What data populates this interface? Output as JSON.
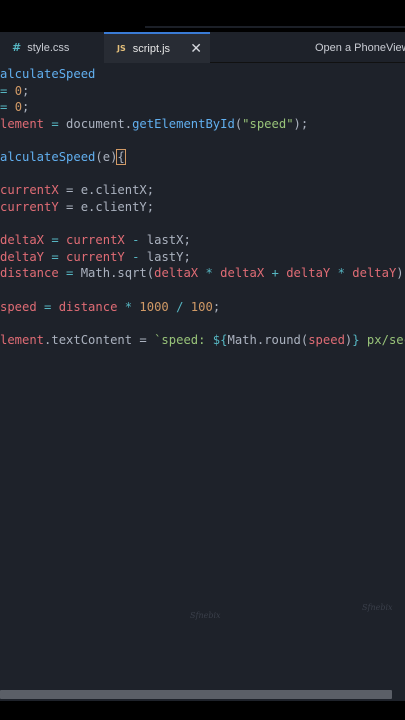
{
  "tabs": {
    "style": {
      "icon": "#",
      "label": "style.css"
    },
    "script": {
      "icon": "JS",
      "label": "script.js",
      "close": "✕"
    },
    "phone": {
      "label": "Open a PhoneView Ta"
    }
  },
  "code": {
    "line1": "alculateSpeed",
    "line2a": "= ",
    "line2b": "0",
    "line2c": ";",
    "line3a": "= ",
    "line3b": "0",
    "line3c": ";",
    "line4a": "lement",
    "line4b": " = ",
    "line4c": "document",
    "line4d": ".",
    "line4e": "getElementById",
    "line4f": "(",
    "line4g": "\"speed\"",
    "line4h": ");",
    "line5a": "alculateSpeed",
    "line5b": "(e)",
    "line5c": "{",
    "line6a": "currentX",
    "line6b": " = e.clientX;",
    "line7a": "currentY",
    "line7b": " = e.clientY;",
    "line8a": "deltaX",
    "line8b": " = ",
    "line8c": "currentX",
    "line8d": " - ",
    "line8e": "lastX",
    "line8f": ";",
    "line9a": "deltaY",
    "line9b": " = ",
    "line9c": "currentY",
    "line9d": " - ",
    "line9e": "lastY",
    "line9f": ";",
    "line10a": "distance",
    "line10b": " = ",
    "line10c": "Math",
    "line10d": ".",
    "line10e": "sqrt",
    "line10f": "(",
    "line10g": "deltaX",
    "line10h": " * ",
    "line10i": "deltaX",
    "line10j": " + ",
    "line10k": "deltaY",
    "line10l": " * ",
    "line10m": "deltaY",
    "line10n": ");",
    "line11a": "speed",
    "line11b": " = ",
    "line11c": "distance",
    "line11d": " * ",
    "line11e": "1000",
    "line11f": " / ",
    "line11g": "100",
    "line11h": ";",
    "line12a": "lement",
    "line12b": ".textContent = ",
    "line12c": "`speed: ",
    "line12d": "${",
    "line12e": "Math",
    "line12f": ".",
    "line12g": "round",
    "line12h": "(",
    "line12i": "speed",
    "line12j": ")",
    "line12k": "}",
    "line12l": " px/sec`",
    "line12m": ";"
  },
  "watermarks": {
    "left": "Sfnebix",
    "right": "Sfnebix"
  },
  "colors": {
    "background": "#1e222a",
    "active_tab": "#282c34",
    "variable": "#e06c75",
    "function": "#61afef",
    "number": "#d19a66",
    "string": "#98c379"
  }
}
